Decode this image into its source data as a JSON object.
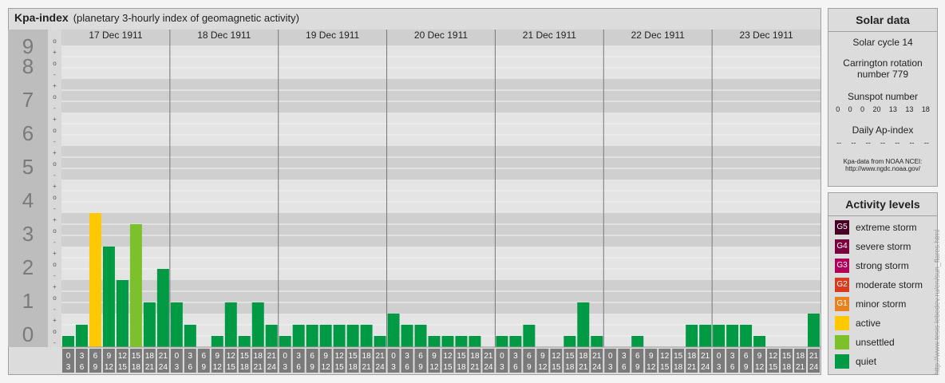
{
  "header": {
    "title": "Kpa-index",
    "subtitle": "(planetary 3-hourly index of geomagnetic activity)"
  },
  "chart_data": {
    "type": "bar",
    "y_levels": [
      "0",
      "1",
      "2",
      "3",
      "4",
      "5",
      "6",
      "7",
      "8",
      "9"
    ],
    "ylim": [
      0,
      9
    ],
    "sub_ticks": [
      "-",
      "o",
      "+"
    ],
    "days": [
      "17 Dec 1911",
      "18 Dec 1911",
      "19 Dec 1911",
      "20 Dec 1911",
      "21 Dec 1911",
      "22 Dec 1911",
      "23 Dec 1911"
    ],
    "interval_starts": [
      "0",
      "3",
      "6",
      "9",
      "12",
      "15",
      "18",
      "21"
    ],
    "interval_ends": [
      "3",
      "6",
      "9",
      "12",
      "15",
      "18",
      "21",
      "24"
    ],
    "values": [
      [
        0.333,
        0.667,
        4.0,
        3.0,
        2.0,
        3.667,
        1.333,
        2.333
      ],
      [
        1.333,
        0.667,
        0.0,
        0.333,
        1.333,
        0.333,
        1.333,
        0.667
      ],
      [
        0.333,
        0.667,
        0.667,
        0.667,
        0.667,
        0.667,
        0.667,
        0.333
      ],
      [
        1.0,
        0.667,
        0.667,
        0.333,
        0.333,
        0.333,
        0.333,
        0.0
      ],
      [
        0.333,
        0.333,
        0.667,
        0.0,
        0.0,
        0.333,
        1.333,
        0.333
      ],
      [
        0.0,
        0.0,
        0.333,
        0.0,
        0.0,
        0.0,
        0.667,
        0.667
      ],
      [
        0.667,
        0.667,
        0.667,
        0.333,
        0.0,
        0.0,
        0.0,
        1.0
      ]
    ],
    "thresholds": [
      {
        "min": 0,
        "max": 3.5,
        "color": "#009944"
      },
      {
        "min": 3.5,
        "max": 4.0,
        "color": "#7dc12a"
      },
      {
        "min": 4.0,
        "max": 5.0,
        "color": "#ffc800"
      }
    ],
    "grid": true
  },
  "solar": {
    "title": "Solar data",
    "cycle": "Solar cycle 14",
    "carrington_1": "Carrington rotation",
    "carrington_2": "number 779",
    "sunspot_label": "Sunspot number",
    "sunspot_values": [
      "0",
      "0",
      "0",
      "20",
      "13",
      "13",
      "18"
    ],
    "ap_label": "Daily Ap-index",
    "ap_values": [
      "--",
      "--",
      "--",
      "--",
      "--",
      "--",
      "--"
    ],
    "source_1": "Kpa-data from NOAA NCEI:",
    "source_2": "http://www.ngdc.noaa.gov/"
  },
  "legend": {
    "title": "Activity levels",
    "items": [
      {
        "badge": "G5",
        "label": "extreme storm",
        "color": "#4a0024"
      },
      {
        "badge": "G4",
        "label": "severe storm",
        "color": "#7a0040"
      },
      {
        "badge": "G3",
        "label": "strong storm",
        "color": "#b0005a"
      },
      {
        "badge": "G2",
        "label": "moderate storm",
        "color": "#d83a1e"
      },
      {
        "badge": "G1",
        "label": "minor storm",
        "color": "#e8821e"
      },
      {
        "badge": "",
        "label": "active",
        "color": "#ffc800"
      },
      {
        "badge": "",
        "label": "unsettled",
        "color": "#7dc12a"
      },
      {
        "badge": "",
        "label": "quiet",
        "color": "#009944"
      }
    ]
  },
  "credit": "http://www.tesis.lebedev.ru/en/sun_flares.html"
}
